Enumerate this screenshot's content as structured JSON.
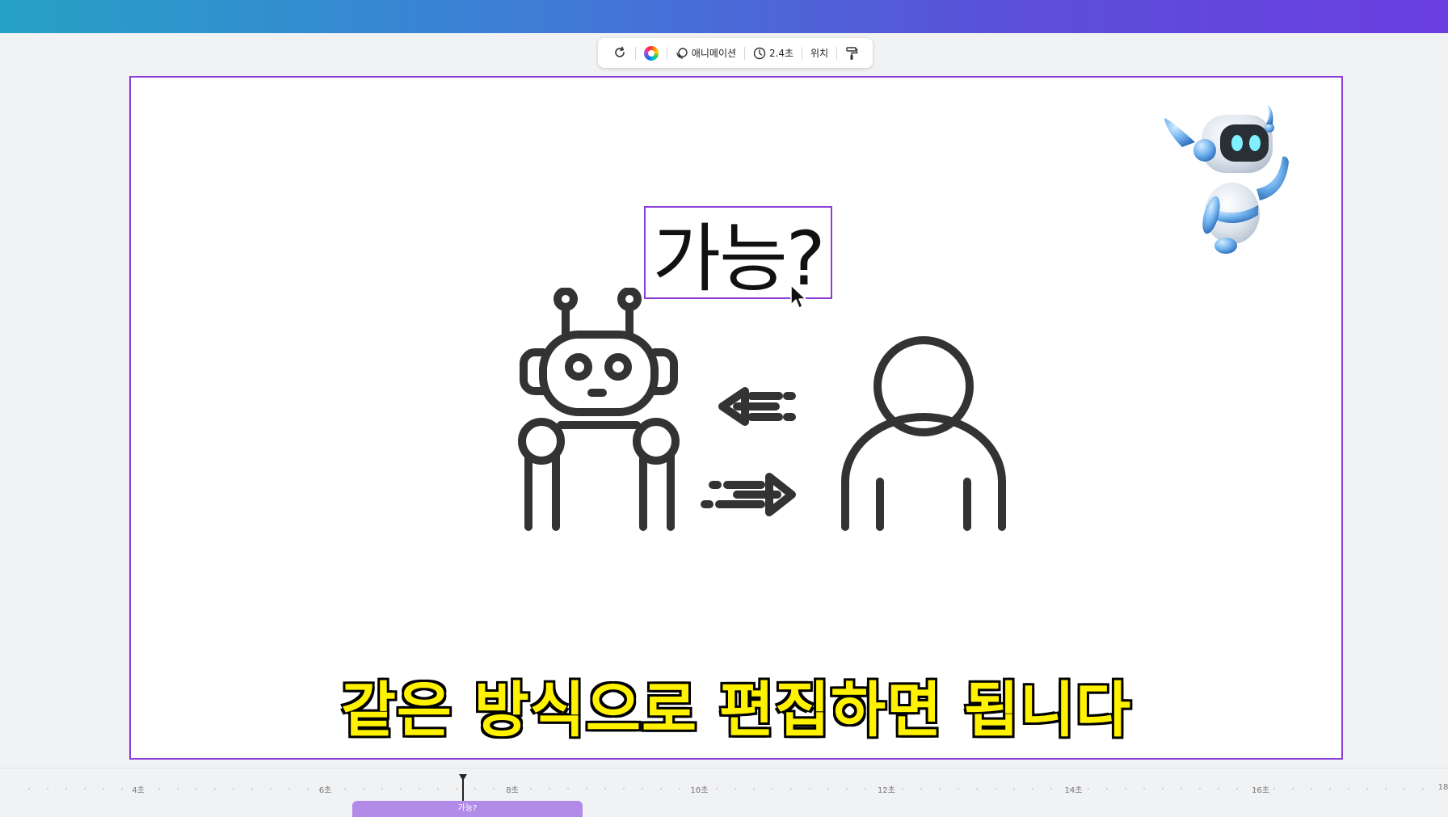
{
  "toolbar": {
    "animation_label": "애니메이션",
    "duration_label": "2.4초",
    "position_label": "위치"
  },
  "canvas": {
    "headline": "가능?",
    "subtitle": "같은 방식으로 편집하면 됩니다"
  },
  "timeline": {
    "ticks": [
      "4초",
      "6초",
      "8초",
      "10초",
      "12초",
      "14초",
      "16초",
      "18"
    ],
    "clip_label": "가능?"
  },
  "colors": {
    "selection": "#8b3fd6",
    "subtitle_fill": "#fff200",
    "clip": "#b28ae8"
  }
}
